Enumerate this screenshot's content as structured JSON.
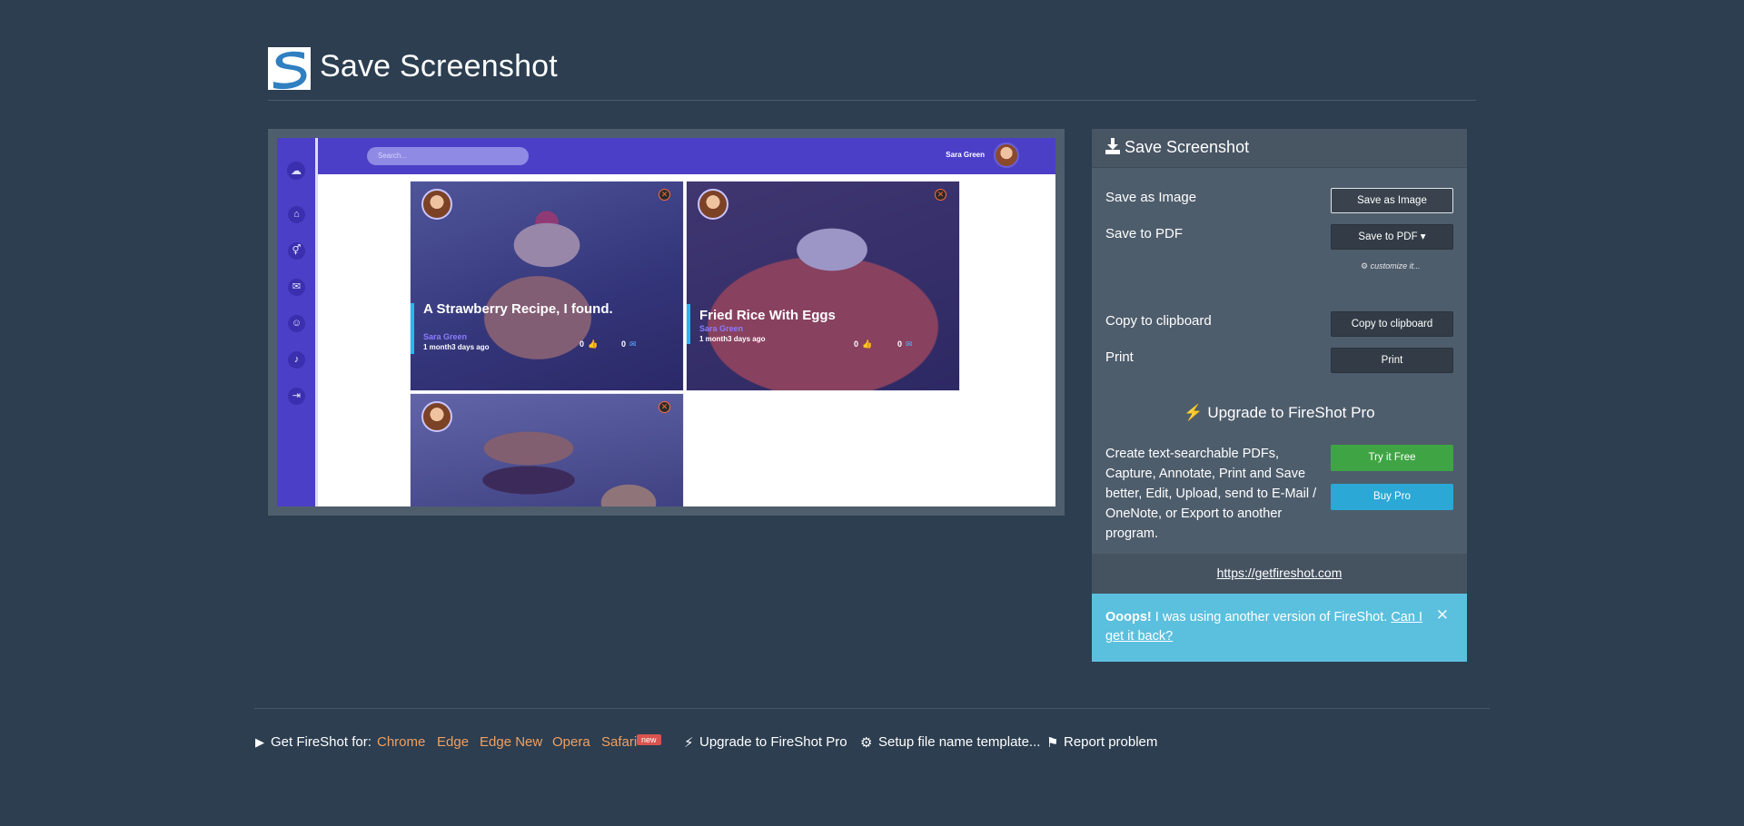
{
  "app": {
    "title": "Save Screenshot"
  },
  "preview": {
    "search_placeholder": "Search...",
    "user_name": "Sara Green",
    "cards": [
      {
        "title": "A Strawberry Recipe, I found.",
        "author": "Sara Green",
        "time": "1 month3 days ago",
        "likes": "0",
        "comments": "0"
      },
      {
        "title": "Fried Rice With Eggs",
        "author": "Sara Green",
        "time": "1 month3 days ago",
        "likes": "0",
        "comments": "0"
      }
    ]
  },
  "panel": {
    "header": "Save Screenshot",
    "save_image_label": "Save as Image",
    "save_image_button": "Save as Image",
    "save_pdf_label": "Save to PDF",
    "save_pdf_button": "Save to PDF ▾",
    "customize": "customize it...",
    "copy_label": "Copy to clipboard",
    "copy_button": "Copy to clipboard",
    "print_label": "Print",
    "print_button": "Print",
    "upgrade_title": "Upgrade to FireShot Pro",
    "description": "Create text-searchable PDFs, Capture, Annotate, Print and Save better, Edit, Upload, send to E-Mail / OneNote, or Export to another program.",
    "try_button": "Try it Free",
    "buy_button": "Buy Pro",
    "site_link": "https://getfireshot.com",
    "alert_bold": "Ooops!",
    "alert_text": " I was using another version of FireShot. ",
    "alert_link": "Can I get it back?"
  },
  "footer": {
    "get_label": "Get FireShot for:",
    "browsers": [
      "Chrome",
      "Edge",
      "Edge New",
      "Opera",
      "Safari"
    ],
    "new_badge": "new",
    "upgrade": "Upgrade to FireShot Pro",
    "setup": "Setup file name template...",
    "report": "Report problem"
  },
  "colors": {
    "background": "#2c3e50",
    "panel": "#4e5d6c",
    "accent_green": "#3fa544",
    "accent_blue": "#2ba8d6",
    "alert": "#5bc0de",
    "link_orange": "#f0a060"
  }
}
